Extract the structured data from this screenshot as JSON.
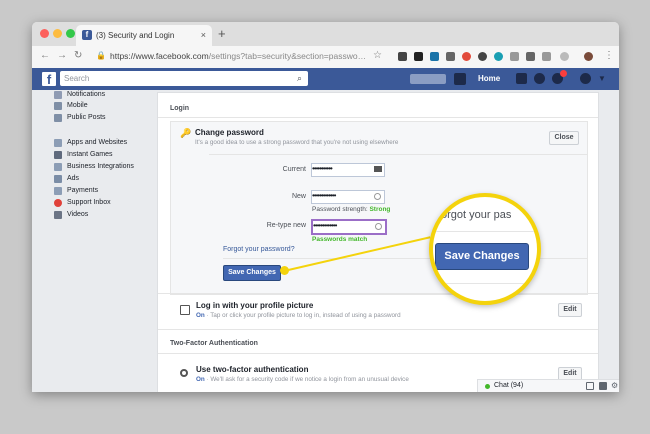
{
  "browser": {
    "tab_title": "(3) Security and Login",
    "tab_close": "×",
    "new_tab": "+",
    "url_main": "https://www.facebook.com",
    "url_rest": "/settings?tab=security&section=passwo…",
    "back_glyph": "←",
    "forward_glyph": "→",
    "reload_glyph": "↻",
    "star_glyph": "☆",
    "menu_glyph": "⋮"
  },
  "fb": {
    "logo": "f",
    "search_placeholder": "Search",
    "search_glyph": "⌕",
    "home": "Home"
  },
  "sidebar": {
    "items": [
      {
        "label": "Notifications",
        "color": "#8f9bb3"
      },
      {
        "label": "Mobile",
        "color": "#7f8fa6"
      },
      {
        "label": "Public Posts",
        "color": "#7f8fa6"
      },
      {
        "label": "Apps and Websites",
        "color": "#8c9db5"
      },
      {
        "label": "Instant Games",
        "color": "#5f6a7d"
      },
      {
        "label": "Business Integrations",
        "color": "#8c9db5"
      },
      {
        "label": "Ads",
        "color": "#7b8da6"
      },
      {
        "label": "Payments",
        "color": "#8c9db5"
      },
      {
        "label": "Support Inbox",
        "color": "#e0413a"
      },
      {
        "label": "Videos",
        "color": "#6b7485"
      }
    ]
  },
  "main": {
    "login_header": "Login",
    "change_password": {
      "title": "Change password",
      "desc": "It's a good idea to use a strong password that you're not using elsewhere",
      "close": "Close",
      "current_label": "Current",
      "current_value": "•••••••••••",
      "new_label": "New",
      "new_value": "•••••••••••••",
      "strength_prefix": "Password strength:",
      "strength_value": "Strong",
      "retype_label": "Re-type new",
      "retype_value": "•••••••••••••",
      "match": "Passwords match",
      "forgot": "Forgot your password?",
      "save": "Save Changes"
    },
    "profile_login": {
      "title": "Log in with your profile picture",
      "status": "On",
      "desc": "· Tap or click your profile picture to log in, instead of using a password",
      "edit": "Edit"
    },
    "two_factor_header": "Two-Factor Authentication",
    "two_factor": {
      "title": "Use two-factor authentication",
      "status": "On",
      "desc": "· We'll ask for a security code if we notice a login from an unusual device",
      "edit": "Edit"
    }
  },
  "zoom": {
    "text": "orgot your pas",
    "button": "Save Changes",
    "accent": "#f4d30c"
  },
  "chat": {
    "label": "Chat (94)"
  }
}
